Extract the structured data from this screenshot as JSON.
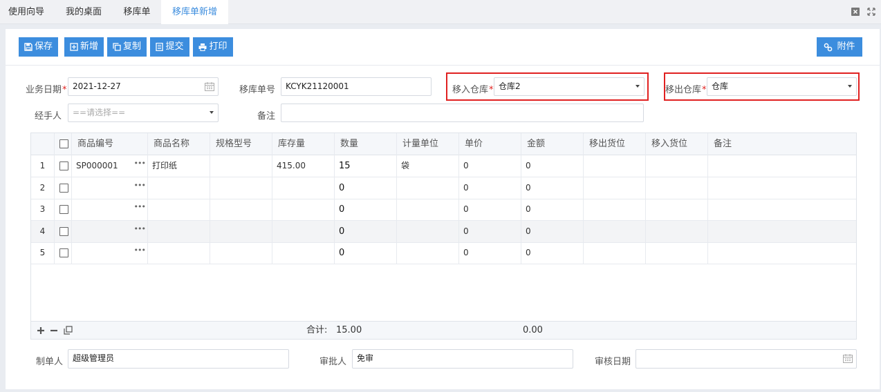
{
  "tabs": [
    {
      "label": "使用向导",
      "active": false
    },
    {
      "label": "我的桌面",
      "active": false
    },
    {
      "label": "移库单",
      "active": false
    },
    {
      "label": "移库单新增",
      "active": true
    }
  ],
  "toolbar": {
    "save": "保存",
    "add": "新增",
    "copy": "复制",
    "submit": "提交",
    "print": "打印",
    "attachment": "附件"
  },
  "form": {
    "business_date_label": "业务日期",
    "business_date": "2021-12-27",
    "order_no_label": "移库单号",
    "order_no": "KCYK21120001",
    "in_warehouse_label": "移入仓库",
    "in_warehouse": "仓库2",
    "out_warehouse_label": "移出仓库",
    "out_warehouse": "仓库",
    "handler_label": "经手人",
    "handler_placeholder": "==请选择==",
    "remark_label": "备注",
    "remark": "",
    "required_mark": "*"
  },
  "grid": {
    "columns": [
      "商品编号",
      "商品名称",
      "规格型号",
      "库存量",
      "数量",
      "计量单位",
      "单价",
      "金额",
      "移出货位",
      "移入货位",
      "备注"
    ],
    "rows": [
      {
        "no": "1",
        "code": "SP000001",
        "name": "打印纸",
        "spec": "",
        "stock": "415.00",
        "qty": "15",
        "unit": "袋",
        "price": "0",
        "amount": "0",
        "out_loc": "",
        "in_loc": "",
        "remark": ""
      },
      {
        "no": "2",
        "code": "",
        "name": "",
        "spec": "",
        "stock": "",
        "qty": "0",
        "unit": "",
        "price": "0",
        "amount": "0",
        "out_loc": "",
        "in_loc": "",
        "remark": ""
      },
      {
        "no": "3",
        "code": "",
        "name": "",
        "spec": "",
        "stock": "",
        "qty": "0",
        "unit": "",
        "price": "0",
        "amount": "0",
        "out_loc": "",
        "in_loc": "",
        "remark": ""
      },
      {
        "no": "4",
        "code": "",
        "name": "",
        "spec": "",
        "stock": "",
        "qty": "0",
        "unit": "",
        "price": "0",
        "amount": "0",
        "out_loc": "",
        "in_loc": "",
        "remark": ""
      },
      {
        "no": "5",
        "code": "",
        "name": "",
        "spec": "",
        "stock": "",
        "qty": "0",
        "unit": "",
        "price": "0",
        "amount": "0",
        "out_loc": "",
        "in_loc": "",
        "remark": ""
      }
    ],
    "footer": {
      "total_label": "合计:",
      "total_qty": "15.00",
      "total_amount": "0.00"
    }
  },
  "bottom": {
    "maker_label": "制单人",
    "maker": "超级管理员",
    "approver_label": "审批人",
    "approver": "免审",
    "audit_date_label": "审核日期",
    "audit_date": ""
  },
  "colors": {
    "accent": "#3c8dde",
    "highlight_box": "#e02020",
    "required": "#e0201e"
  },
  "icons": [
    "save-icon",
    "add-icon",
    "copy-icon",
    "submit-icon",
    "print-icon",
    "link-icon",
    "calendar-icon",
    "close-icon",
    "fullscreen-icon",
    "plus-icon",
    "minus-icon",
    "copy-row-icon"
  ]
}
